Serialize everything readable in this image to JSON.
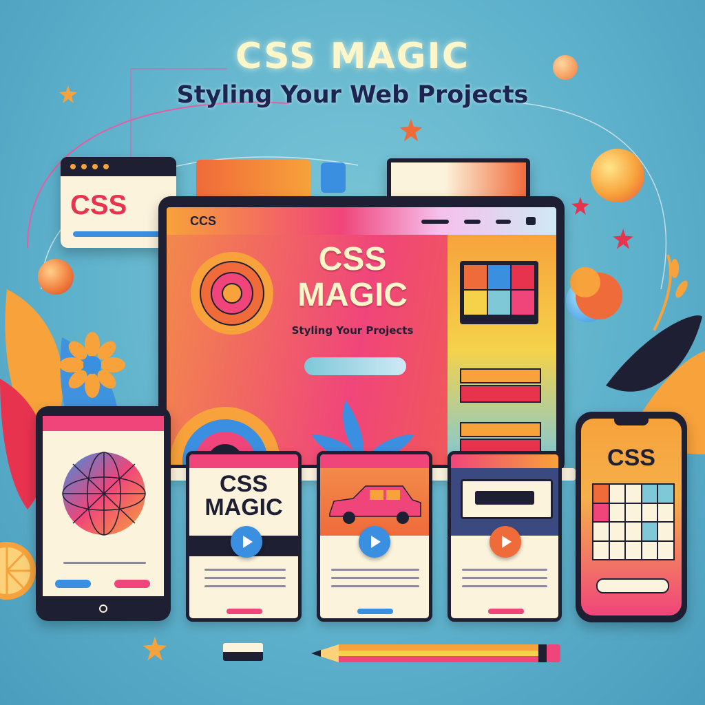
{
  "title": "CSS MAGIC",
  "subtitle": "Styling Your Web Projects",
  "browser_card": {
    "label": "CSS"
  },
  "monitor": {
    "nav_logo": "CCS",
    "hero_title_line1": "CSS",
    "hero_title_line2": "MAGIC",
    "hero_subtitle": "Styling Your Projects"
  },
  "cards": [
    {
      "title_line1": "CSS",
      "title_line2": "MAGIC"
    },
    {},
    {}
  ],
  "phone": {
    "label": "CSS"
  },
  "colors": {
    "background": "#5fb2cc",
    "pink": "#f0457a",
    "orange": "#f7a23b",
    "yellow": "#f5d24a",
    "navy": "#1e1f33",
    "cream": "#fbf3dc",
    "blue": "#3b8fe0"
  }
}
